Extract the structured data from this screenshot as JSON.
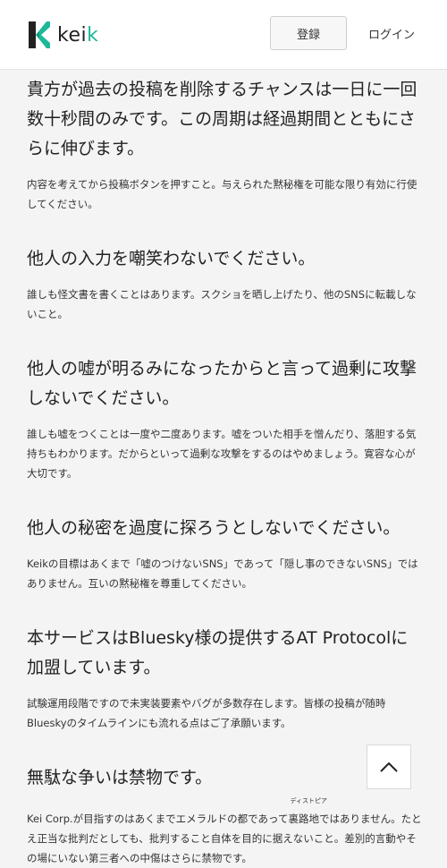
{
  "header": {
    "logo_text_a": "kei",
    "logo_text_b": "k",
    "register_label": "登録",
    "login_label": "ログイン"
  },
  "rules": [
    {
      "title": "貴方が過去の投稿を削除するチャンスは一日に一回数十秒間のみです。この周期は経過期間とともにさらに伸びます。",
      "body": "内容を考えてから投稿ボタンを押すこと。与えられた黙秘権を可能な限り有効に行使してください。"
    },
    {
      "title": "他人の入力を嘲笑わないでください。",
      "body": "誰しも怪文書を書くことはあります。スクショを晒し上げたり、他のSNSに転載しないこと。"
    },
    {
      "title": "他人の嘘が明るみになったからと言って過剰に攻撃しないでください。",
      "body": "誰しも嘘をつくことは一度や二度あります。嘘をついた相手を憎んだり、落胆する気持ちもわかります。だからといって過剰な攻撃をするのはやめましょう。寛容な心が大切です。"
    },
    {
      "title": "他人の秘密を過度に探ろうとしないでください。",
      "body": "Keikの目標はあくまで「嘘のつけないSNS」であって「隠し事のできないSNS」ではありません。互いの黙秘権を尊重してください。"
    },
    {
      "title": "本サービスはBluesky様の提供するAT Protocolに加盟しています。",
      "body": "試験運用段階ですので未実装要素やバグが多数存在します。皆様の投稿が随時Blueskyのタイムラインにも流れる点はご了承願います。"
    },
    {
      "title": "無駄な争いは禁物です。",
      "body_before": "Kei Corp.が目指すのはあくまでエメラルドの都であって",
      "ruby_base": "裏路地",
      "ruby_text": "ディストピア",
      "body_after": "ではありません。たとえ正当な批判だとしても、批判すること自体を目的に据えないこと。差別的言動やその場にいない第三者への中傷はさらに禁物です。"
    }
  ],
  "scroll_top": {
    "icon": "chevron-up-icon"
  },
  "colors": {
    "brand": "#1db99a",
    "background": "#f4f4f4"
  }
}
